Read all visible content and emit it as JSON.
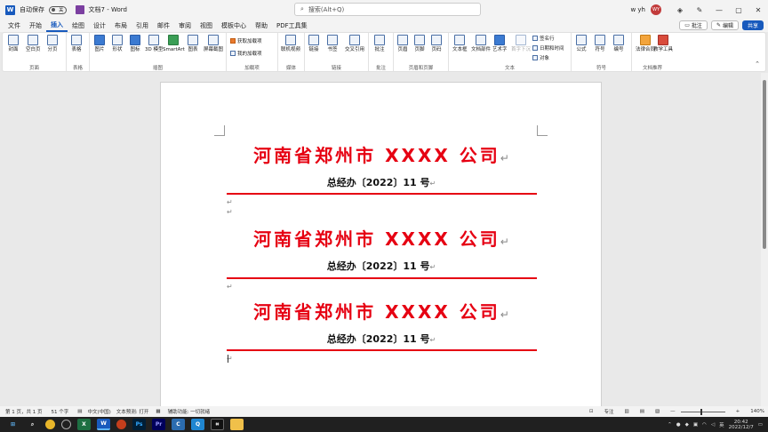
{
  "titlebar": {
    "autosave_label": "自动保存",
    "autosave_state": "关",
    "doc_title": "文档7 - Word",
    "search_placeholder": "搜索(Alt+Q)",
    "user_name": "w yh",
    "avatar_initials": "WY"
  },
  "tabs": [
    "文件",
    "开始",
    "插入",
    "绘图",
    "设计",
    "布局",
    "引用",
    "邮件",
    "审阅",
    "视图",
    "模板中心",
    "帮助",
    "PDF工具集"
  ],
  "active_tab": "插入",
  "tab_actions": {
    "comment": "批注",
    "edit": "编辑",
    "share": "共享"
  },
  "ribbon": {
    "groups": {
      "pages": "页面",
      "tables": "表格",
      "illustrations": "插图",
      "addins": "加载项",
      "media": "媒体",
      "links": "链接",
      "comments": "批注",
      "header_footer": "页眉和页脚",
      "text": "文本",
      "symbols": "符号",
      "recommend": "文档推荐"
    },
    "buttons": {
      "cover": "封面",
      "blank": "空白页",
      "pagebreak": "分页",
      "table": "表格",
      "picture": "图片",
      "shape": "形状",
      "icon": "图标",
      "model3d": "3D 模型",
      "smartart": "SmartArt",
      "chart": "图表",
      "screenshot": "屏幕截图",
      "get_addins": "获取加载项",
      "my_addins": "我的加载项",
      "video": "联机视频",
      "link": "链接",
      "bookmark": "书签",
      "crossref": "交叉引用",
      "comment": "批注",
      "header": "页眉",
      "footer": "页脚",
      "pagenum": "页码",
      "textbox": "文本框",
      "quickparts": "文档部件",
      "wordart": "艺术字",
      "dropcap": "首字下沉",
      "signature": "签名行",
      "datetime": "日期和时间",
      "object": "对象",
      "equation": "公式",
      "symbol": "符号",
      "number": "编号",
      "legal": "法律合同",
      "edu": "教学工具"
    }
  },
  "document": {
    "blocks": [
      {
        "company": "河南省郑州市 XXXX 公司",
        "docno": "总经办〔2022〕11 号"
      },
      {
        "company": "河南省郑州市 XXXX 公司",
        "docno": "总经办〔2022〕11 号"
      },
      {
        "company": "河南省郑州市 XXXX 公司",
        "docno": "总经办〔2022〕11 号"
      }
    ],
    "para_mark": "↵"
  },
  "status": {
    "page": "第 1 页，共 1 页",
    "words": "51 个字",
    "lang": "中文(中国)",
    "predict": "文本预测: 打开",
    "accessibility": "辅助功能: 一切就绪",
    "focus": "专注",
    "zoom": "140%"
  },
  "clock": {
    "time": "20:42",
    "date": "2022/12/7"
  }
}
